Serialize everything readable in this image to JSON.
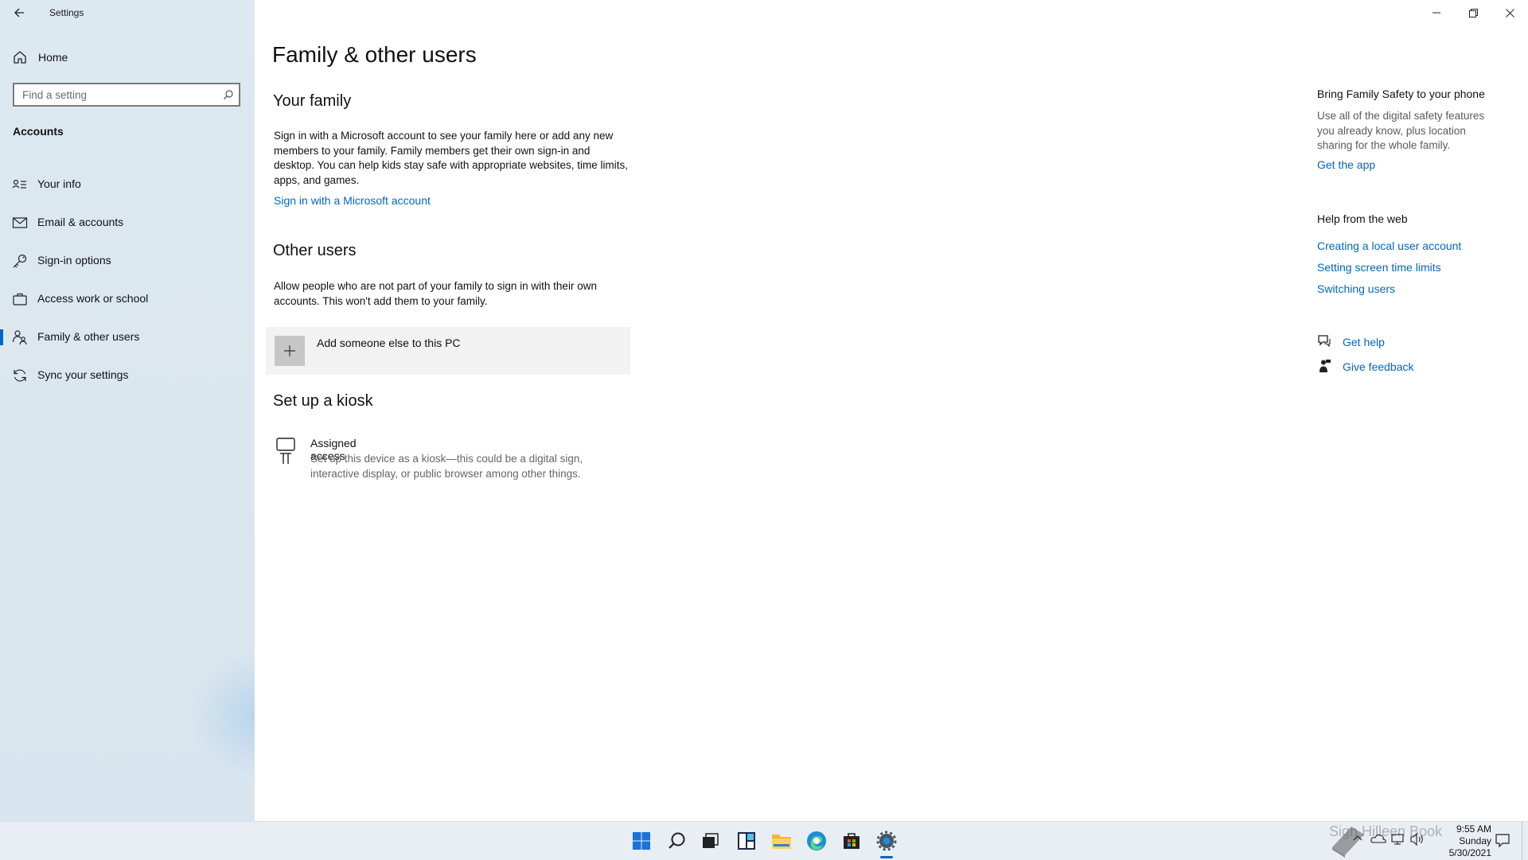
{
  "window": {
    "title": "Settings",
    "controls": {
      "minimize": "minimize-icon",
      "restore": "restore-icon",
      "close": "close-icon"
    }
  },
  "sidebar": {
    "home_label": "Home",
    "search_placeholder": "Find a setting",
    "section_label": "Accounts",
    "items": [
      {
        "label": "Your info",
        "icon": "contact-card-icon"
      },
      {
        "label": "Email & accounts",
        "icon": "mail-icon"
      },
      {
        "label": "Sign-in options",
        "icon": "key-icon"
      },
      {
        "label": "Access work or school",
        "icon": "briefcase-icon"
      },
      {
        "label": "Family & other users",
        "icon": "family-icon",
        "active": true
      },
      {
        "label": "Sync your settings",
        "icon": "sync-icon"
      }
    ]
  },
  "main": {
    "page_title": "Family & other users",
    "your_family": {
      "heading": "Your family",
      "description": "Sign in with a Microsoft account to see your family here or add any new members to your family. Family members get their own sign-in and desktop. You can help kids stay safe with appropriate websites, time limits, apps, and games.",
      "link": "Sign in with a Microsoft account"
    },
    "other_users": {
      "heading": "Other users",
      "description": "Allow people who are not part of your family to sign in with their own accounts. This won't add them to your family.",
      "add_label": "Add someone else to this PC"
    },
    "kiosk": {
      "heading": "Set up a kiosk",
      "title": "Assigned access",
      "description": "Set up this device as a kiosk—this could be a digital sign, interactive display, or public browser among other things."
    }
  },
  "right_panel": {
    "family_safety": {
      "heading": "Bring Family Safety to your phone",
      "description": "Use all of the digital safety features you already know, plus location sharing for the whole family.",
      "link": "Get the app"
    },
    "help_web": {
      "heading": "Help from the web",
      "links": [
        "Creating a local user account",
        "Setting screen time limits",
        "Switching users"
      ]
    },
    "get_help": "Get help",
    "give_feedback": "Give feedback"
  },
  "taskbar": {
    "icons": [
      "start-icon",
      "search-icon",
      "task-view-icon",
      "widgets-icon",
      "file-explorer-icon",
      "edge-icon",
      "store-icon",
      "settings-icon"
    ],
    "active": "settings-icon",
    "clock": {
      "time": "9:55 AM",
      "day": "Sunday",
      "date": "5/30/2021"
    },
    "watermark": "Sign Hilleen Book",
    "accent": "#0067c0"
  }
}
